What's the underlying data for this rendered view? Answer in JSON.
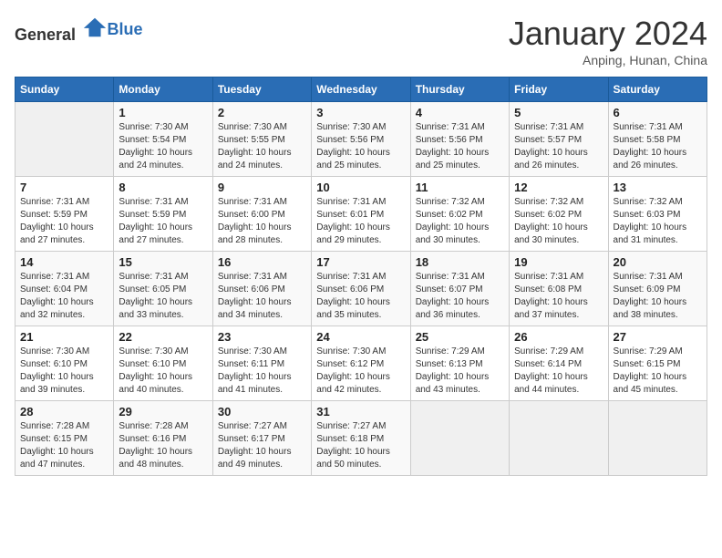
{
  "header": {
    "logo": {
      "text_general": "General",
      "text_blue": "Blue"
    },
    "month_title": "January 2024",
    "subtitle": "Anping, Hunan, China"
  },
  "days_of_week": [
    "Sunday",
    "Monday",
    "Tuesday",
    "Wednesday",
    "Thursday",
    "Friday",
    "Saturday"
  ],
  "weeks": [
    [
      {
        "num": "",
        "empty": true
      },
      {
        "num": "1",
        "sunrise": "7:30 AM",
        "sunset": "5:54 PM",
        "daylight": "10 hours and 24 minutes."
      },
      {
        "num": "2",
        "sunrise": "7:30 AM",
        "sunset": "5:55 PM",
        "daylight": "10 hours and 24 minutes."
      },
      {
        "num": "3",
        "sunrise": "7:30 AM",
        "sunset": "5:56 PM",
        "daylight": "10 hours and 25 minutes."
      },
      {
        "num": "4",
        "sunrise": "7:31 AM",
        "sunset": "5:56 PM",
        "daylight": "10 hours and 25 minutes."
      },
      {
        "num": "5",
        "sunrise": "7:31 AM",
        "sunset": "5:57 PM",
        "daylight": "10 hours and 26 minutes."
      },
      {
        "num": "6",
        "sunrise": "7:31 AM",
        "sunset": "5:58 PM",
        "daylight": "10 hours and 26 minutes."
      }
    ],
    [
      {
        "num": "7",
        "sunrise": "7:31 AM",
        "sunset": "5:59 PM",
        "daylight": "10 hours and 27 minutes."
      },
      {
        "num": "8",
        "sunrise": "7:31 AM",
        "sunset": "5:59 PM",
        "daylight": "10 hours and 27 minutes."
      },
      {
        "num": "9",
        "sunrise": "7:31 AM",
        "sunset": "6:00 PM",
        "daylight": "10 hours and 28 minutes."
      },
      {
        "num": "10",
        "sunrise": "7:31 AM",
        "sunset": "6:01 PM",
        "daylight": "10 hours and 29 minutes."
      },
      {
        "num": "11",
        "sunrise": "7:32 AM",
        "sunset": "6:02 PM",
        "daylight": "10 hours and 30 minutes."
      },
      {
        "num": "12",
        "sunrise": "7:32 AM",
        "sunset": "6:02 PM",
        "daylight": "10 hours and 30 minutes."
      },
      {
        "num": "13",
        "sunrise": "7:32 AM",
        "sunset": "6:03 PM",
        "daylight": "10 hours and 31 minutes."
      }
    ],
    [
      {
        "num": "14",
        "sunrise": "7:31 AM",
        "sunset": "6:04 PM",
        "daylight": "10 hours and 32 minutes."
      },
      {
        "num": "15",
        "sunrise": "7:31 AM",
        "sunset": "6:05 PM",
        "daylight": "10 hours and 33 minutes."
      },
      {
        "num": "16",
        "sunrise": "7:31 AM",
        "sunset": "6:06 PM",
        "daylight": "10 hours and 34 minutes."
      },
      {
        "num": "17",
        "sunrise": "7:31 AM",
        "sunset": "6:06 PM",
        "daylight": "10 hours and 35 minutes."
      },
      {
        "num": "18",
        "sunrise": "7:31 AM",
        "sunset": "6:07 PM",
        "daylight": "10 hours and 36 minutes."
      },
      {
        "num": "19",
        "sunrise": "7:31 AM",
        "sunset": "6:08 PM",
        "daylight": "10 hours and 37 minutes."
      },
      {
        "num": "20",
        "sunrise": "7:31 AM",
        "sunset": "6:09 PM",
        "daylight": "10 hours and 38 minutes."
      }
    ],
    [
      {
        "num": "21",
        "sunrise": "7:30 AM",
        "sunset": "6:10 PM",
        "daylight": "10 hours and 39 minutes."
      },
      {
        "num": "22",
        "sunrise": "7:30 AM",
        "sunset": "6:10 PM",
        "daylight": "10 hours and 40 minutes."
      },
      {
        "num": "23",
        "sunrise": "7:30 AM",
        "sunset": "6:11 PM",
        "daylight": "10 hours and 41 minutes."
      },
      {
        "num": "24",
        "sunrise": "7:30 AM",
        "sunset": "6:12 PM",
        "daylight": "10 hours and 42 minutes."
      },
      {
        "num": "25",
        "sunrise": "7:29 AM",
        "sunset": "6:13 PM",
        "daylight": "10 hours and 43 minutes."
      },
      {
        "num": "26",
        "sunrise": "7:29 AM",
        "sunset": "6:14 PM",
        "daylight": "10 hours and 44 minutes."
      },
      {
        "num": "27",
        "sunrise": "7:29 AM",
        "sunset": "6:15 PM",
        "daylight": "10 hours and 45 minutes."
      }
    ],
    [
      {
        "num": "28",
        "sunrise": "7:28 AM",
        "sunset": "6:15 PM",
        "daylight": "10 hours and 47 minutes."
      },
      {
        "num": "29",
        "sunrise": "7:28 AM",
        "sunset": "6:16 PM",
        "daylight": "10 hours and 48 minutes."
      },
      {
        "num": "30",
        "sunrise": "7:27 AM",
        "sunset": "6:17 PM",
        "daylight": "10 hours and 49 minutes."
      },
      {
        "num": "31",
        "sunrise": "7:27 AM",
        "sunset": "6:18 PM",
        "daylight": "10 hours and 50 minutes."
      },
      {
        "num": "",
        "empty": true
      },
      {
        "num": "",
        "empty": true
      },
      {
        "num": "",
        "empty": true
      }
    ]
  ],
  "labels": {
    "sunrise": "Sunrise:",
    "sunset": "Sunset:",
    "daylight": "Daylight:"
  }
}
